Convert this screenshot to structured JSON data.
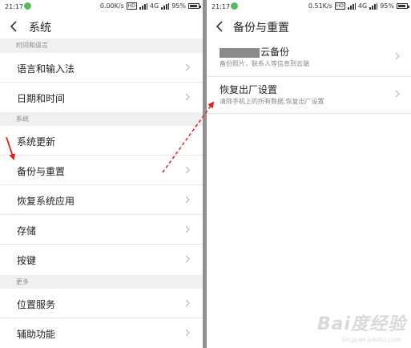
{
  "left": {
    "status": {
      "time": "21:17",
      "speed": "0.00K/s",
      "hd": "HD",
      "network": "4G",
      "battery": "95%"
    },
    "title": "系统",
    "sections": [
      {
        "header": "时间和语言"
      },
      {
        "header": "系统"
      },
      {
        "header": "更多"
      }
    ],
    "items": [
      {
        "label": "语言和输入法"
      },
      {
        "label": "日期和时间"
      },
      {
        "label": "系统更新"
      },
      {
        "label": "备份与重置"
      },
      {
        "label": "恢复系统应用"
      },
      {
        "label": "存储"
      },
      {
        "label": "按键"
      },
      {
        "label": "位置服务"
      },
      {
        "label": "辅助功能"
      }
    ]
  },
  "right": {
    "status": {
      "time": "21:17",
      "speed": "0.51K/s",
      "hd": "HD",
      "network": "4G",
      "battery": "95%"
    },
    "title": "备份与重置",
    "items": [
      {
        "label": "云备份",
        "sub": "备份照片，联系人等信息到云端"
      },
      {
        "label": "恢复出厂设置",
        "sub": "清除手机上的所有数据,恢复出厂设置"
      }
    ]
  },
  "watermark": {
    "logo": "Bai度经验",
    "url": "jingyan.baidu.com"
  },
  "colors": {
    "annotation": "#e02020",
    "app_dot": "#59b960",
    "section_bg": "#f0f0f0",
    "divider": "#8f8f8f"
  },
  "icons": [
    "back-icon",
    "chevron-right-icon",
    "signal-icon",
    "battery-icon",
    "hd-icon"
  ]
}
